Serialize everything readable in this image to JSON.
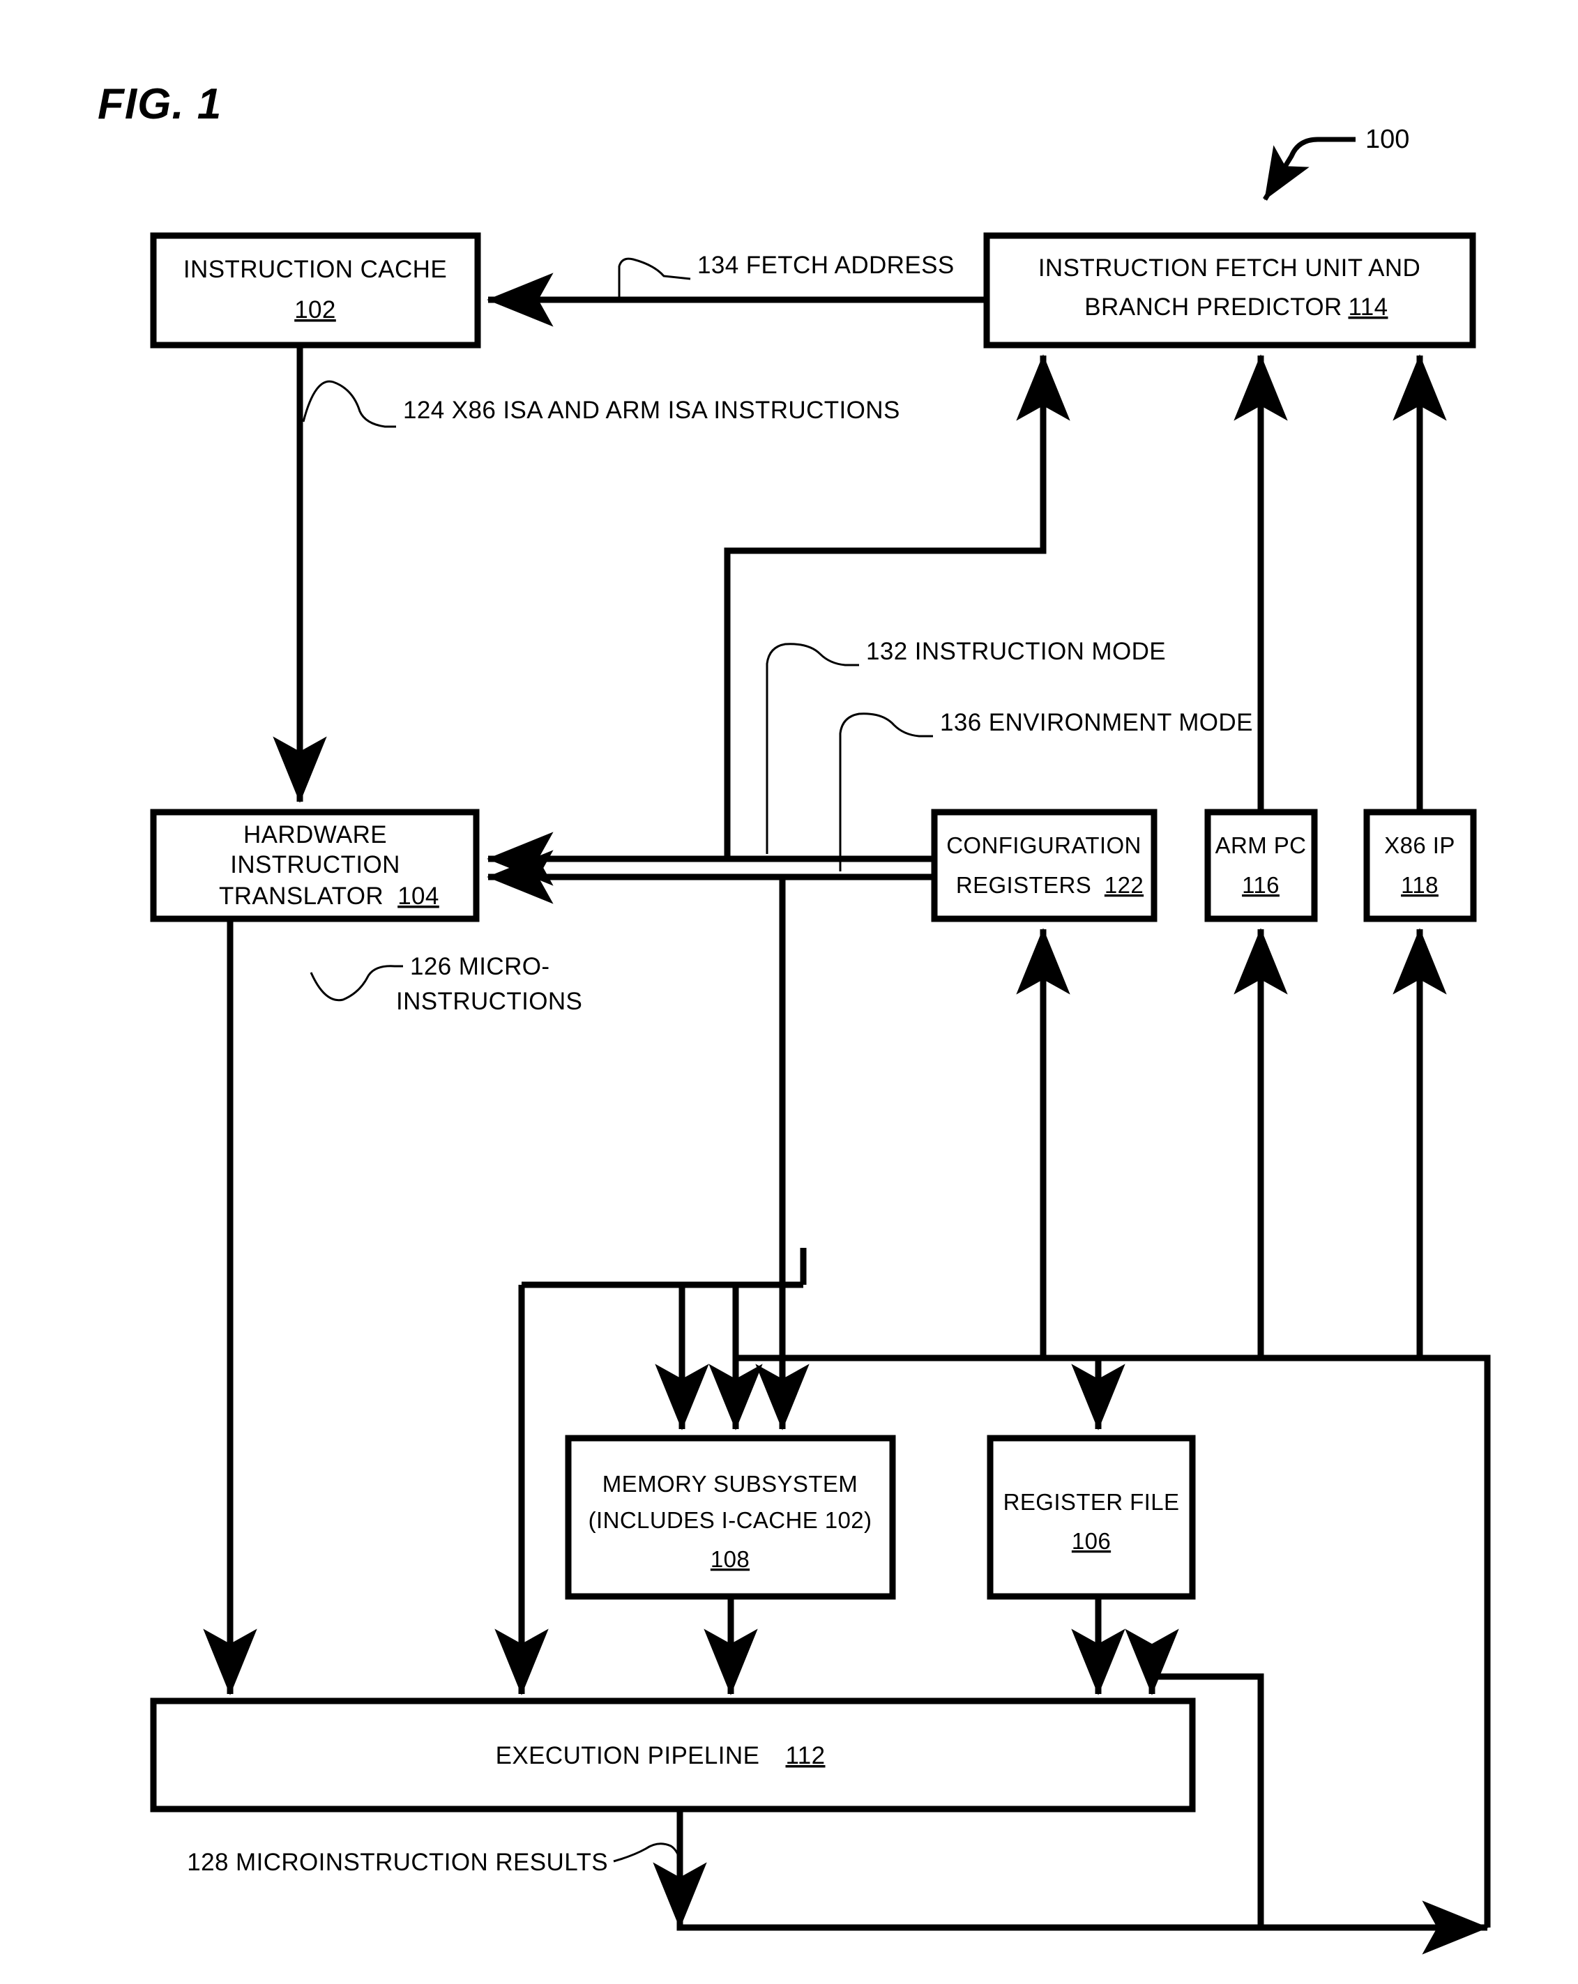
{
  "figure": {
    "label": "FIG. 1",
    "reference_numeral": "100"
  },
  "boxes": {
    "instruction_cache": {
      "line1": "INSTRUCTION CACHE",
      "num": "102"
    },
    "fetch_unit": {
      "line1": "INSTRUCTION FETCH UNIT AND",
      "line2": "BRANCH PREDICTOR",
      "num": "114"
    },
    "translator": {
      "line1": "HARDWARE",
      "line2": "INSTRUCTION",
      "line3": "TRANSLATOR",
      "num": "104"
    },
    "config_registers": {
      "line1": "CONFIGURATION",
      "line2": "REGISTERS",
      "num": "122"
    },
    "arm_pc": {
      "line1": "ARM PC",
      "num": "116"
    },
    "x86_ip": {
      "line1": "X86 IP",
      "num": "118"
    },
    "memory_subsystem": {
      "line1": "MEMORY SUBSYSTEM",
      "line2": "(INCLUDES I-CACHE 102)",
      "num": "108"
    },
    "register_file": {
      "line1": "REGISTER FILE",
      "num": "106"
    },
    "execution_pipeline": {
      "line1": "EXECUTION PIPELINE",
      "num": "112"
    }
  },
  "signals": {
    "fetch_address": "134 FETCH ADDRESS",
    "isa_instructions": "124 X86 ISA AND ARM ISA INSTRUCTIONS",
    "instruction_mode": "132 INSTRUCTION MODE",
    "environment_mode": "136 ENVIRONMENT MODE",
    "microinstructions_line1": "126 MICRO-",
    "microinstructions_line2": "INSTRUCTIONS",
    "microinstruction_results": "128 MICROINSTRUCTION RESULTS"
  },
  "colors": {
    "ink": "#000000",
    "paper": "#ffffff"
  }
}
